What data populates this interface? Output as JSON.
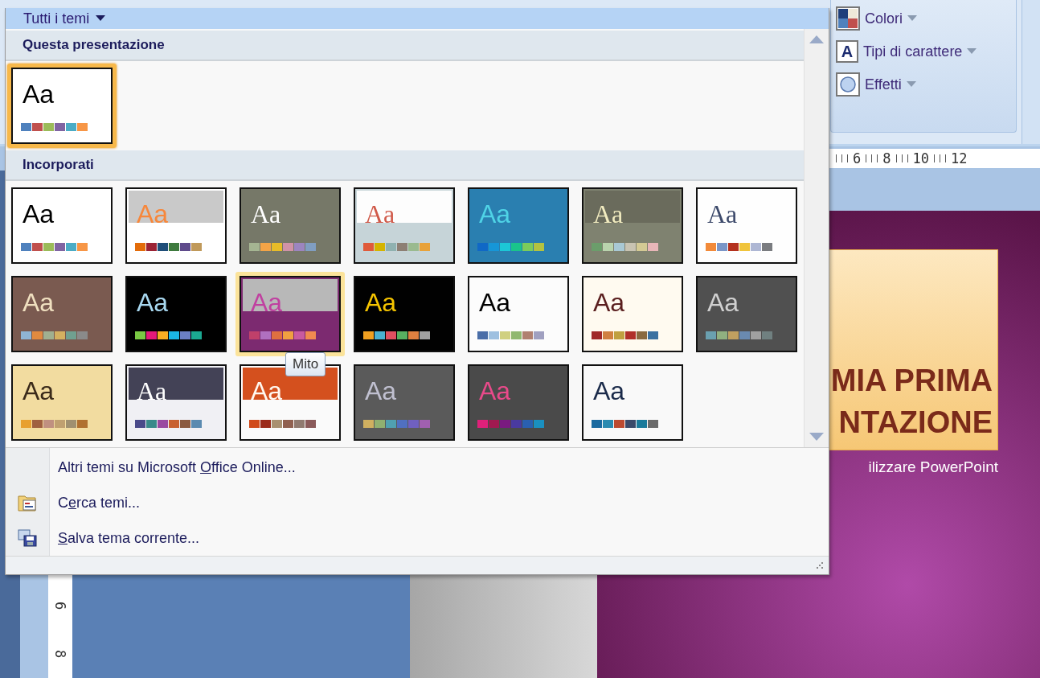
{
  "gallery": {
    "title": "Tutti i temi",
    "tooltip": "Mito",
    "sections": [
      {
        "heading": "Questa presentazione",
        "themes": [
          {
            "color": "#ffffff",
            "sample": {
              "text": "Aa",
              "kind": "sans",
              "color": "#000000"
            },
            "swatches": [
              {
                "color": "#4f81bd"
              },
              {
                "color": "#c0504d"
              },
              {
                "color": "#9bbb59"
              },
              {
                "color": "#8064a2"
              },
              {
                "color": "#4bacc6"
              },
              {
                "color": "#f79646"
              }
            ],
            "selected": true,
            "hovered": false
          }
        ]
      },
      {
        "heading": "Incorporati",
        "themes": [
          {
            "color": "#ffffff",
            "sample": {
              "text": "Aa",
              "kind": "sans",
              "color": "#000000"
            },
            "swatches": [
              {
                "color": "#4f81bd"
              },
              {
                "color": "#c0504d"
              },
              {
                "color": "#9bbb59"
              },
              {
                "color": "#8064a2"
              },
              {
                "color": "#4bacc6"
              },
              {
                "color": "#f79646"
              }
            ],
            "selected": false,
            "hovered": false
          },
          {
            "color": "#ffffff",
            "band": {
              "color": "#c9c9c9"
            },
            "sample": {
              "text": "Aa",
              "kind": "sans",
              "color": "#f7873b"
            },
            "swatches": [
              {
                "color": "#e36c0a"
              },
              {
                "color": "#9b2335"
              },
              {
                "color": "#1f4e79"
              },
              {
                "color": "#3e7a3e"
              },
              {
                "color": "#5f4b8b"
              },
              {
                "color": "#c0995a"
              }
            ],
            "selected": false,
            "hovered": false
          },
          {
            "color": "#767868",
            "sample": {
              "text": "Aa",
              "kind": "serif",
              "color": "#ffffff"
            },
            "swatches": [
              {
                "color": "#a5b592"
              },
              {
                "color": "#f3a447"
              },
              {
                "color": "#e7bc29"
              },
              {
                "color": "#d092a7"
              },
              {
                "color": "#9c85c0"
              },
              {
                "color": "#809ec2"
              }
            ],
            "selected": false,
            "hovered": false
          },
          {
            "color": "#c6d4d8",
            "band": {
              "color": "#fdfdfd"
            },
            "sample": {
              "text": "Aa",
              "kind": "serif",
              "color": "#d05a4a"
            },
            "swatches": [
              {
                "color": "#e05a3a"
              },
              {
                "color": "#d4b400"
              },
              {
                "color": "#8fb1b0"
              },
              {
                "color": "#8d7f74"
              },
              {
                "color": "#9aba8f"
              },
              {
                "color": "#e8a23a"
              }
            ],
            "selected": false,
            "hovered": false
          },
          {
            "color": "#2a7fb0",
            "sample": {
              "text": "Aa",
              "kind": "sans",
              "color": "#4fd3e6"
            },
            "swatches": [
              {
                "color": "#1068c6"
              },
              {
                "color": "#1696d8"
              },
              {
                "color": "#1cc7d6"
              },
              {
                "color": "#1ac48b"
              },
              {
                "color": "#7ccc5b"
              },
              {
                "color": "#b3c240"
              }
            ],
            "selected": false,
            "hovered": false
          },
          {
            "color": "#7f8270",
            "band": {
              "color": "#6a6b5c"
            },
            "sample": {
              "text": "Aa",
              "kind": "serif",
              "color": "#f2ecc0"
            },
            "swatches": [
              {
                "color": "#6b9d6b"
              },
              {
                "color": "#b9d3ad"
              },
              {
                "color": "#a8c8d4"
              },
              {
                "color": "#c8c3b2"
              },
              {
                "color": "#d4ca94"
              },
              {
                "color": "#e8b6b8"
              }
            ],
            "selected": false,
            "hovered": false
          },
          {
            "color": "#fefefe",
            "sample": {
              "text": "Aa",
              "kind": "serif",
              "color": "#3d4a6b"
            },
            "swatches": [
              {
                "color": "#f28a3a"
              },
              {
                "color": "#7a96c8"
              },
              {
                "color": "#b4311e"
              },
              {
                "color": "#f0c43c"
              },
              {
                "color": "#aeb7d4"
              },
              {
                "color": "#7a7c80"
              }
            ],
            "selected": false,
            "hovered": false
          },
          {
            "color": "#7a5a50",
            "sample": {
              "text": "Aa",
              "kind": "sans",
              "color": "#f0e0c0"
            },
            "swatches": [
              {
                "color": "#8fb4d4"
              },
              {
                "color": "#e08a40"
              },
              {
                "color": "#a0b090"
              },
              {
                "color": "#d4b060"
              },
              {
                "color": "#70a090"
              },
              {
                "color": "#8a8a8a"
              }
            ],
            "selected": false,
            "hovered": false
          },
          {
            "color": "#000000",
            "sample": {
              "text": "Aa",
              "kind": "sans",
              "color": "#a8d8f0"
            },
            "swatches": [
              {
                "color": "#7ac943"
              },
              {
                "color": "#e5197a"
              },
              {
                "color": "#f6ae23"
              },
              {
                "color": "#1ab7e5"
              },
              {
                "color": "#6b7fc4"
              },
              {
                "color": "#1ba891"
              }
            ],
            "selected": false,
            "hovered": false
          },
          {
            "color": "#7c2a70",
            "band": {
              "color": "#b8b8b8"
            },
            "sample": {
              "text": "Aa",
              "kind": "sans",
              "color": "#c040a0"
            },
            "swatches": [
              {
                "color": "#c0406a"
              },
              {
                "color": "#b070c0"
              },
              {
                "color": "#e07040"
              },
              {
                "color": "#f0a040"
              },
              {
                "color": "#c85aa0"
              },
              {
                "color": "#f08a50"
              }
            ],
            "selected": false,
            "hovered": true
          },
          {
            "color": "#010101",
            "sample": {
              "text": "Aa",
              "kind": "sans",
              "color": "#f5c400"
            },
            "swatches": [
              {
                "color": "#f0a020"
              },
              {
                "color": "#4ab0d0"
              },
              {
                "color": "#e05060"
              },
              {
                "color": "#58b060"
              },
              {
                "color": "#e08040"
              },
              {
                "color": "#a0a0a0"
              }
            ],
            "selected": false,
            "hovered": false
          },
          {
            "color": "#fcfcfc",
            "sample": {
              "text": "Aa",
              "kind": "sans",
              "color": "#000000"
            },
            "swatches": [
              {
                "color": "#4a6ea8"
              },
              {
                "color": "#9ec0e0"
              },
              {
                "color": "#d0d080"
              },
              {
                "color": "#90b870"
              },
              {
                "color": "#b08070"
              },
              {
                "color": "#a0a0c0"
              }
            ],
            "selected": false,
            "hovered": false
          },
          {
            "color": "#fffaf0",
            "sample": {
              "text": "Aa",
              "kind": "sans",
              "color": "#5a1e1e"
            },
            "swatches": [
              {
                "color": "#a02828"
              },
              {
                "color": "#d08040"
              },
              {
                "color": "#c0a040"
              },
              {
                "color": "#b0302a"
              },
              {
                "color": "#8a6a40"
              },
              {
                "color": "#3a70a0"
              }
            ],
            "selected": false,
            "hovered": false
          },
          {
            "color": "#505050",
            "sample": {
              "text": "Aa",
              "kind": "sans",
              "color": "#d0d0d0"
            },
            "swatches": [
              {
                "color": "#6aa0b0"
              },
              {
                "color": "#90b080"
              },
              {
                "color": "#c0a060"
              },
              {
                "color": "#6a8ab0"
              },
              {
                "color": "#a0a0a0"
              },
              {
                "color": "#708080"
              }
            ],
            "selected": false,
            "hovered": false
          },
          {
            "color": "#f2dca0",
            "sample": {
              "text": "Aa",
              "kind": "sans",
              "color": "#3a2a1a"
            },
            "swatches": [
              {
                "color": "#e8a030"
              },
              {
                "color": "#a06040"
              },
              {
                "color": "#c09080"
              },
              {
                "color": "#c0a070"
              },
              {
                "color": "#a09070"
              },
              {
                "color": "#b07030"
              }
            ],
            "selected": false,
            "hovered": false
          },
          {
            "color": "#f0f0f4",
            "band": {
              "color": "#434256"
            },
            "sample": {
              "text": "Aa",
              "kind": "serif",
              "color": "#ffffff"
            },
            "swatches": [
              {
                "color": "#4a4a8a"
              },
              {
                "color": "#3a8a8a"
              },
              {
                "color": "#9a4aa0"
              },
              {
                "color": "#c86030"
              },
              {
                "color": "#8a5a40"
              },
              {
                "color": "#5a8ab0"
              }
            ],
            "selected": false,
            "hovered": false
          },
          {
            "color": "#fafafa",
            "band": {
              "color": "#d4501e"
            },
            "sample": {
              "text": "Aa",
              "kind": "sans",
              "color": "#fff8f0"
            },
            "swatches": [
              {
                "color": "#d04a1a"
              },
              {
                "color": "#9a2a1a"
              },
              {
                "color": "#a89070"
              },
              {
                "color": "#906050"
              },
              {
                "color": "#907a70"
              },
              {
                "color": "#8a5a5a"
              }
            ],
            "selected": false,
            "hovered": false
          },
          {
            "color": "#5a5a5a",
            "sample": {
              "text": "Aa",
              "kind": "sans",
              "color": "#c0c0d0"
            },
            "swatches": [
              {
                "color": "#d0b060"
              },
              {
                "color": "#90b070"
              },
              {
                "color": "#50a0b0"
              },
              {
                "color": "#5070c0"
              },
              {
                "color": "#7060c0"
              },
              {
                "color": "#a060b0"
              }
            ],
            "selected": false,
            "hovered": false
          },
          {
            "color": "#4a4a4a",
            "sample": {
              "text": "Aa",
              "kind": "sans",
              "color": "#e84a8a"
            },
            "swatches": [
              {
                "color": "#e0207a"
              },
              {
                "color": "#a01a50"
              },
              {
                "color": "#7a1a80"
              },
              {
                "color": "#4a3aa0"
              },
              {
                "color": "#2a60b0"
              },
              {
                "color": "#1a90c0"
              }
            ],
            "selected": false,
            "hovered": false
          },
          {
            "color": "#f9f9f9",
            "sample": {
              "text": "Aa",
              "kind": "sans",
              "color": "#1a2a4a"
            },
            "swatches": [
              {
                "color": "#1a6aa0"
              },
              {
                "color": "#2a8ab0"
              },
              {
                "color": "#bc4a30"
              },
              {
                "color": "#3a4a6a"
              },
              {
                "color": "#1a7a9a"
              },
              {
                "color": "#6a6a6a"
              }
            ],
            "selected": false,
            "hovered": false
          }
        ]
      }
    ]
  },
  "menu": [
    {
      "kind": "plain",
      "text_before": "Altri temi su Microsoft ",
      "access_key": "O",
      "text_after": "ffice Online..."
    },
    {
      "kind": "browse",
      "text_before": "C",
      "access_key": "e",
      "text_after": "rca temi..."
    },
    {
      "kind": "save",
      "access_key": "S",
      "text_after": "alva tema corrente..."
    }
  ],
  "ribbon": {
    "buttons": [
      {
        "kind": "colors",
        "label": "Colori"
      },
      {
        "kind": "fonts",
        "label": "Tipi di carattere",
        "icon_text": "A"
      },
      {
        "kind": "effects",
        "label": "Effetti"
      }
    ]
  },
  "ruler": {
    "horizontal": [
      "6",
      "8",
      "10",
      "12"
    ],
    "vertical": [
      "6",
      "8"
    ]
  },
  "slide": {
    "title_lines": [
      "MIA PRIMA",
      "NTAZIONE"
    ],
    "subtitle": "ilizzare PowerPoint"
  }
}
